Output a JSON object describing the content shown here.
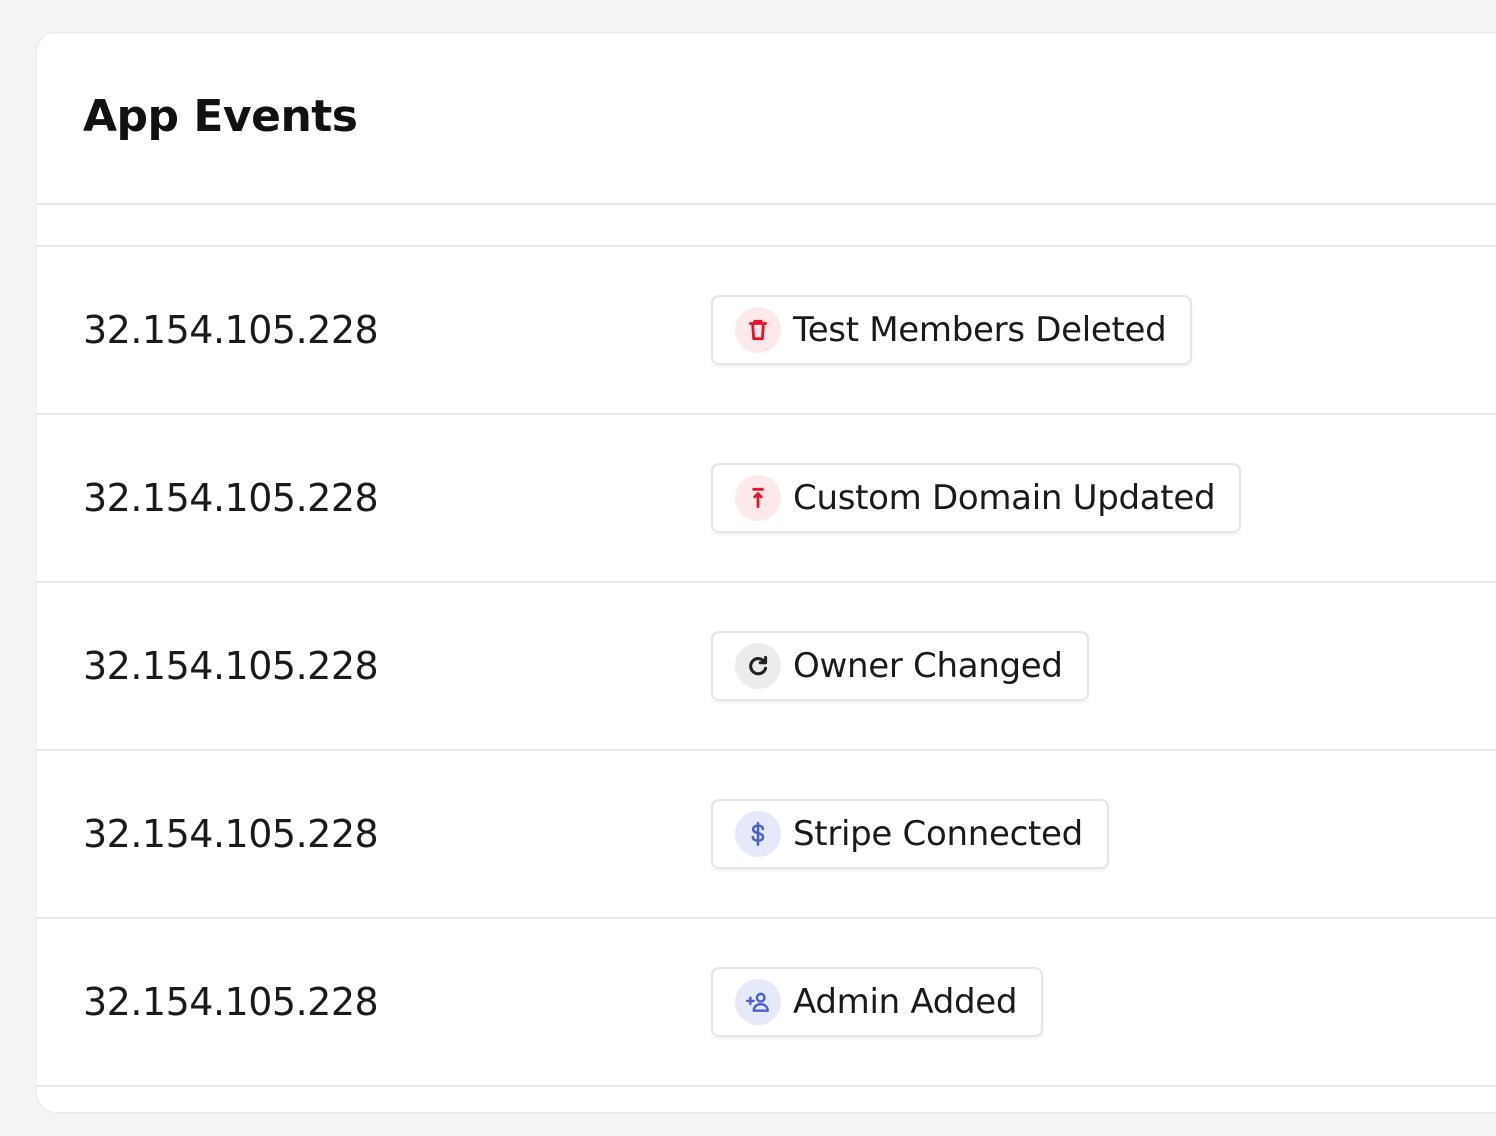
{
  "card": {
    "title": "App Events"
  },
  "events": [
    {
      "ip": "32.154.105.228",
      "label": "Test Members Deleted",
      "icon": "trash-icon",
      "icon_color": "#e5132e",
      "icon_bg": "#fde8ea"
    },
    {
      "ip": "32.154.105.228",
      "label": "Custom Domain Updated",
      "icon": "upload-arrow-icon",
      "icon_color": "#e5132e",
      "icon_bg": "#fde8ea"
    },
    {
      "ip": "32.154.105.228",
      "label": "Owner Changed",
      "icon": "refresh-icon",
      "icon_color": "#222222",
      "icon_bg": "#ececee"
    },
    {
      "ip": "32.154.105.228",
      "label": "Stripe Connected",
      "icon": "dollar-icon",
      "icon_color": "#4a5fd0",
      "icon_bg": "#e6e9f9"
    },
    {
      "ip": "32.154.105.228",
      "label": "Admin Added",
      "icon": "user-plus-icon",
      "icon_color": "#4a5fd0",
      "icon_bg": "#e6e9f9"
    }
  ]
}
